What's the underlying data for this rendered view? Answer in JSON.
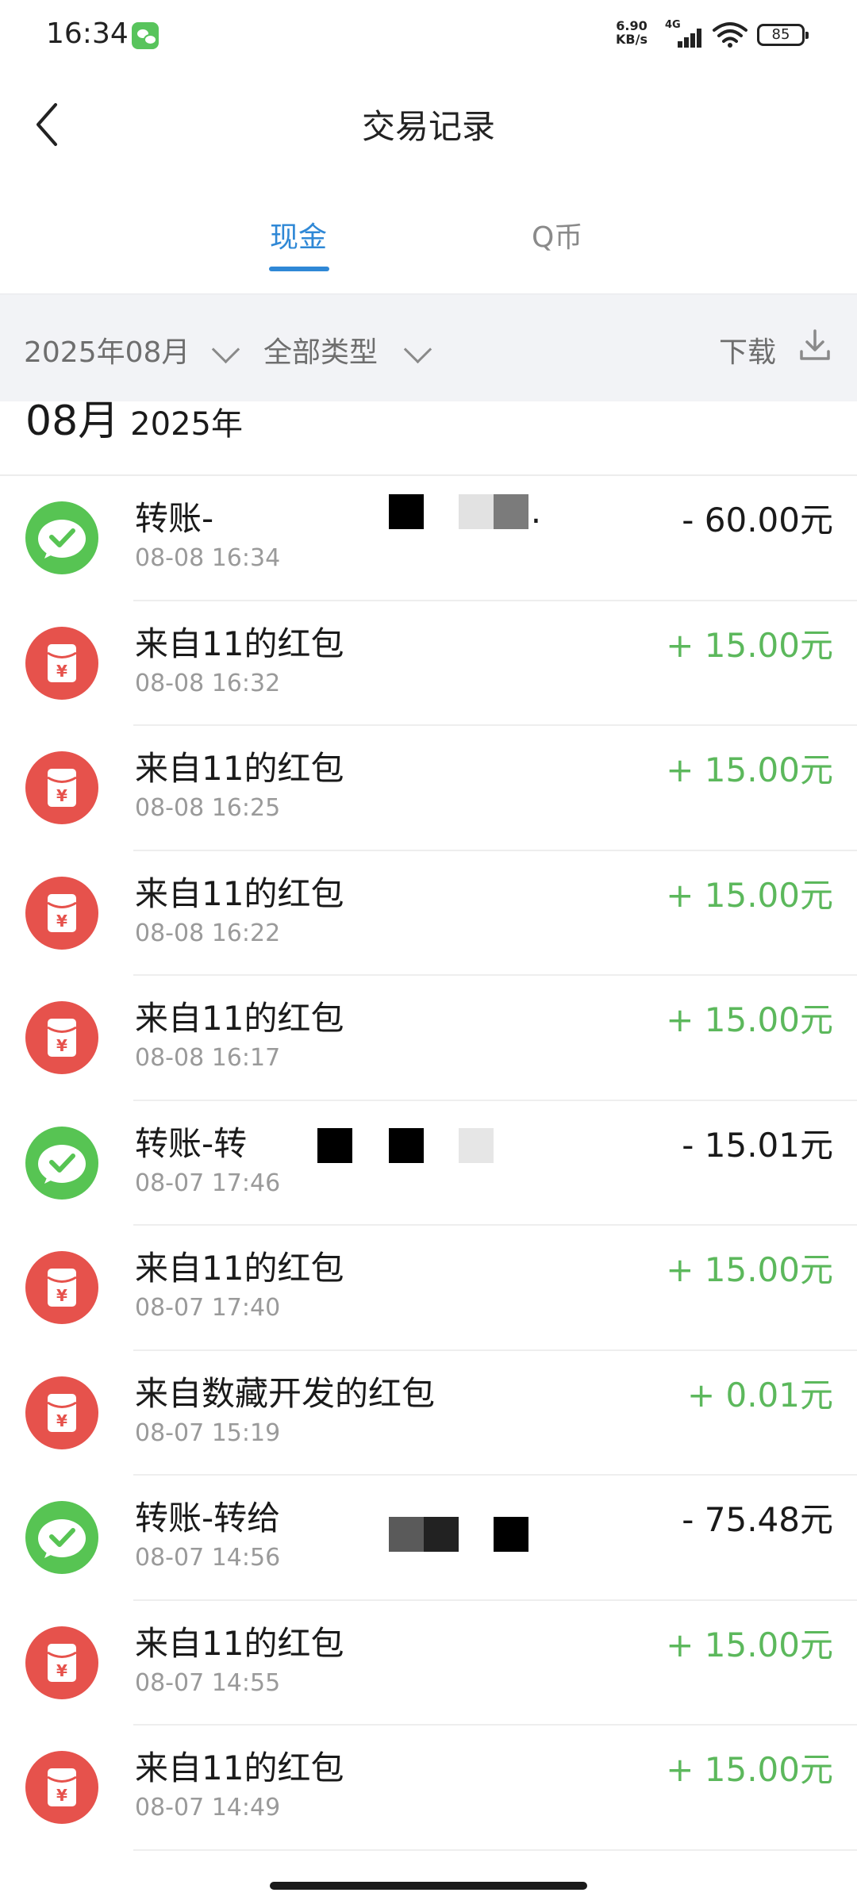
{
  "status_bar": {
    "time": "16:34",
    "net_speed_value": "6.90",
    "net_speed_unit": "KB/s",
    "network": "4G",
    "battery": "85"
  },
  "header": {
    "title": "交易记录"
  },
  "tabs": [
    {
      "label": "现金",
      "active": true
    },
    {
      "label": "Q币",
      "active": false
    }
  ],
  "filters": {
    "month": "2025年08月",
    "type": "全部类型",
    "download": "下载"
  },
  "month_section": {
    "month": "08月",
    "year": "2025年"
  },
  "transactions": [
    {
      "title": "转账-",
      "time": "08-08 16:34",
      "amount": "- 60.00元",
      "kind": "transfer",
      "direction": "out",
      "trailing": "..."
    },
    {
      "title": "来自11的红包",
      "time": "08-08 16:32",
      "amount": "+ 15.00元",
      "kind": "redpacket",
      "direction": "in"
    },
    {
      "title": "来自11的红包",
      "time": "08-08 16:25",
      "amount": "+ 15.00元",
      "kind": "redpacket",
      "direction": "in"
    },
    {
      "title": "来自11的红包",
      "time": "08-08 16:22",
      "amount": "+ 15.00元",
      "kind": "redpacket",
      "direction": "in"
    },
    {
      "title": "来自11的红包",
      "time": "08-08 16:17",
      "amount": "+ 15.00元",
      "kind": "redpacket",
      "direction": "in"
    },
    {
      "title": "转账-转",
      "time": "08-07 17:46",
      "amount": "- 15.01元",
      "kind": "transfer",
      "direction": "out"
    },
    {
      "title": "来自11的红包",
      "time": "08-07 17:40",
      "amount": "+ 15.00元",
      "kind": "redpacket",
      "direction": "in"
    },
    {
      "title": "来自数藏开发的红包",
      "time": "08-07 15:19",
      "amount": "+ 0.01元",
      "kind": "redpacket",
      "direction": "in"
    },
    {
      "title": "转账-转给",
      "time": "08-07 14:56",
      "amount": "- 75.48元",
      "kind": "transfer",
      "direction": "out"
    },
    {
      "title": "来自11的红包",
      "time": "08-07 14:55",
      "amount": "+ 15.00元",
      "kind": "redpacket",
      "direction": "in"
    },
    {
      "title": "来自11的红包",
      "time": "08-07 14:49",
      "amount": "+ 15.00元",
      "kind": "redpacket",
      "direction": "in"
    }
  ],
  "colors": {
    "accent": "#2f88d6",
    "income": "#5cb85c",
    "transfer_icon": "#57c453",
    "redpacket_icon": "#e6524c",
    "filter_bg": "#f2f3f6"
  }
}
